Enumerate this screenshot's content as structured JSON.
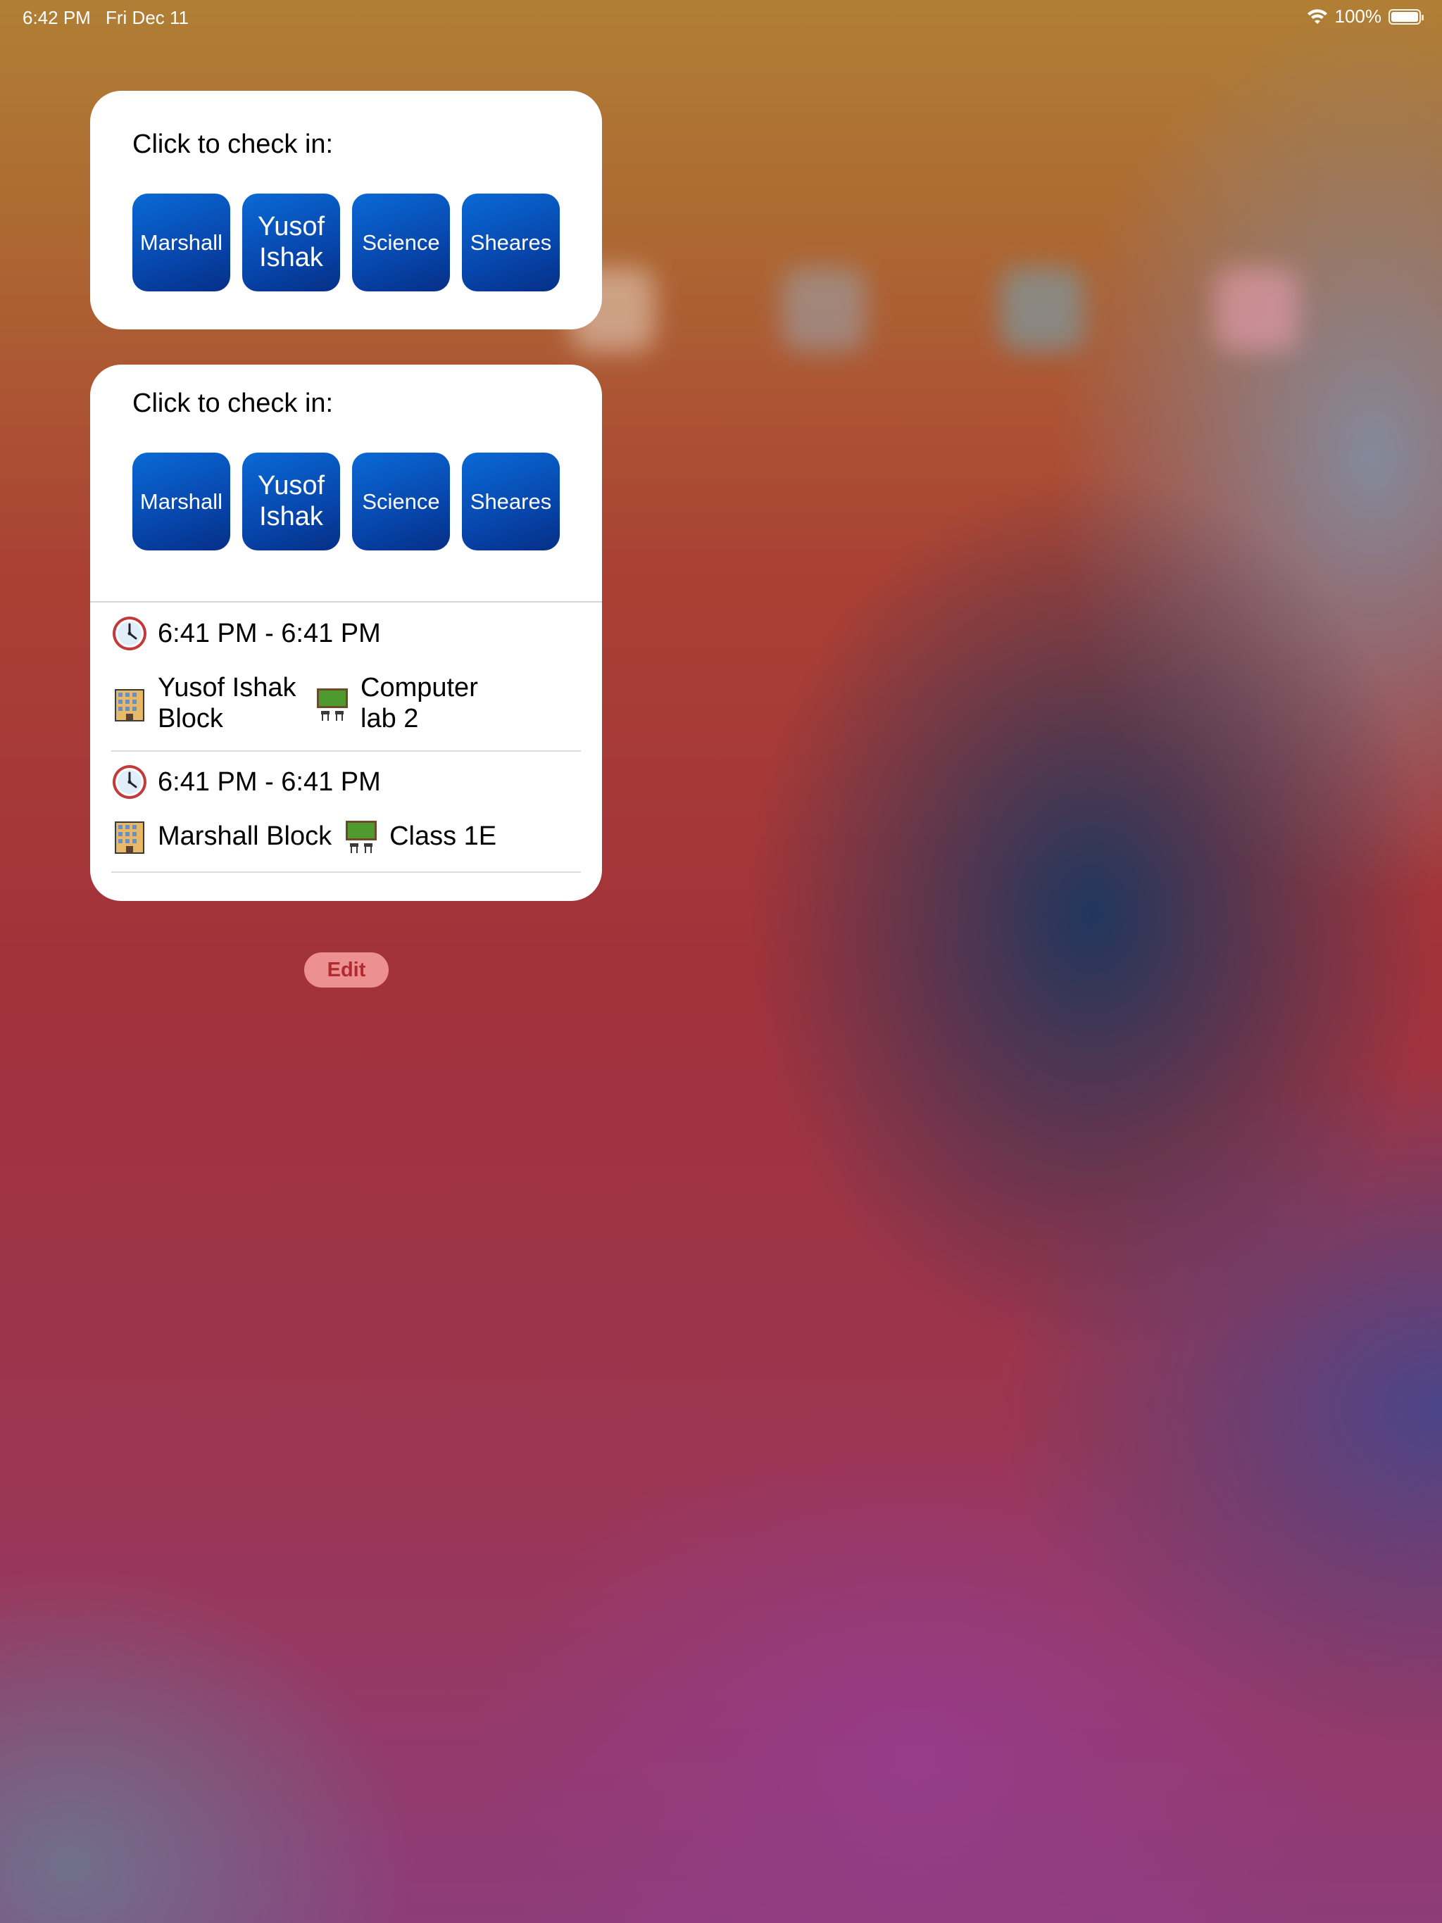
{
  "status_bar": {
    "time": "6:42 PM",
    "date": "Fri Dec 11",
    "battery_text": "100%",
    "battery_level": 1.0,
    "icons": [
      "wifi-icon",
      "battery-icon"
    ]
  },
  "widget1": {
    "prompt": "Click to check in:",
    "buttons": [
      {
        "label": "Marshall"
      },
      {
        "label": "Yusof Ishak"
      },
      {
        "label": "Science"
      },
      {
        "label": "Sheares"
      }
    ]
  },
  "widget2": {
    "prompt": "Click to check in:",
    "buttons": [
      {
        "label": "Marshall"
      },
      {
        "label": "Yusof Ishak"
      },
      {
        "label": "Science"
      },
      {
        "label": "Sheares"
      }
    ],
    "checkins": [
      {
        "time_range": "6:41 PM - 6:41 PM",
        "block": "Yusof Ishak Block",
        "room": "Computer lab 2"
      },
      {
        "time_range": "6:41 PM - 6:41 PM",
        "block": "Marshall Block",
        "room": "Class 1E"
      }
    ]
  },
  "edit_label": "Edit",
  "colors": {
    "button_blue": "#0746ac",
    "edit_bg": "#f09696",
    "edit_text": "#b02a30"
  }
}
